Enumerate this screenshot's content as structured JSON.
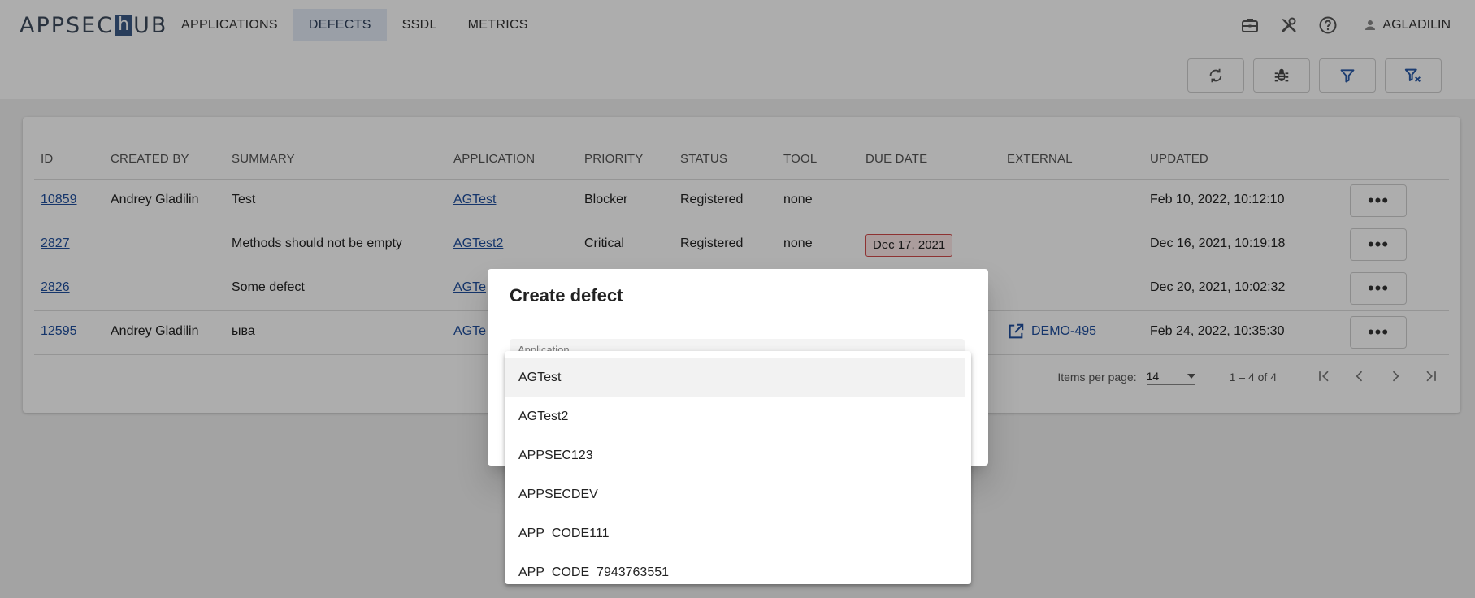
{
  "brand": {
    "logo_left": "APPSEC",
    "logo_h": "h",
    "logo_right": "UB"
  },
  "nav": [
    {
      "label": "APPLICATIONS"
    },
    {
      "label": "DEFECTS"
    },
    {
      "label": "SSDL"
    },
    {
      "label": "METRICS"
    }
  ],
  "user": {
    "name": "AGLADILIN"
  },
  "table": {
    "headers": [
      "ID",
      "CREATED BY",
      "SUMMARY",
      "APPLICATION",
      "PRIORITY",
      "STATUS",
      "TOOL",
      "DUE DATE",
      "EXTERNAL",
      "UPDATED"
    ],
    "rows": [
      {
        "id": "10859",
        "created_by": "Andrey Gladilin",
        "summary": "Test",
        "application": "AGTest",
        "priority": "Blocker",
        "status": "Registered",
        "tool": "none",
        "due_date": "",
        "external": "",
        "updated": "Feb 10, 2022, 10:12:10"
      },
      {
        "id": "2827",
        "created_by": "",
        "summary": "Methods should not be empty",
        "application": "AGTest2",
        "priority": "Critical",
        "status": "Registered",
        "tool": "none",
        "due_date": "Dec 17, 2021",
        "external": "",
        "updated": "Dec 16, 2021, 10:19:18"
      },
      {
        "id": "2826",
        "created_by": "",
        "summary": "Some defect",
        "application": "AGTe",
        "priority": "",
        "status": "",
        "tool": "",
        "due_date": "",
        "external": "",
        "updated": "Dec 20, 2021, 10:02:32"
      },
      {
        "id": "12595",
        "created_by": "Andrey Gladilin",
        "summary": "ыва",
        "application": "AGTe",
        "priority": "",
        "status": "",
        "tool": "",
        "due_date": "",
        "external": "DEMO-495",
        "updated": "Feb 24, 2022, 10:35:30"
      }
    ],
    "more_label": "•••"
  },
  "paginator": {
    "items_per_page_label": "Items per page:",
    "items_per_page": "14",
    "range": "1 – 4 of 4"
  },
  "dialog": {
    "title": "Create defect",
    "field_label": "Application"
  },
  "dropdown": {
    "options": [
      "AGTest",
      "AGTest2",
      "APPSEC123",
      "APPSECDEV",
      "APP_CODE111",
      "APP_CODE_7943763551"
    ],
    "highlighted": "AGTest"
  },
  "icons": [
    "briefcase-icon",
    "tools-icon",
    "help-icon",
    "person-icon",
    "refresh-icon",
    "bug-icon",
    "filter-icon",
    "clear-filter-icon",
    "open-external-icon",
    "first-page-icon",
    "prev-page-icon",
    "next-page-icon",
    "last-page-icon",
    "dropdown-arrow-icon"
  ],
  "colors": {
    "accent": "#3b5a86",
    "link": "#1f4f9e",
    "overdue_border": "#d24a4a",
    "overdue_fill": "#fde8e8",
    "nav_active": "#e3ebf6"
  }
}
